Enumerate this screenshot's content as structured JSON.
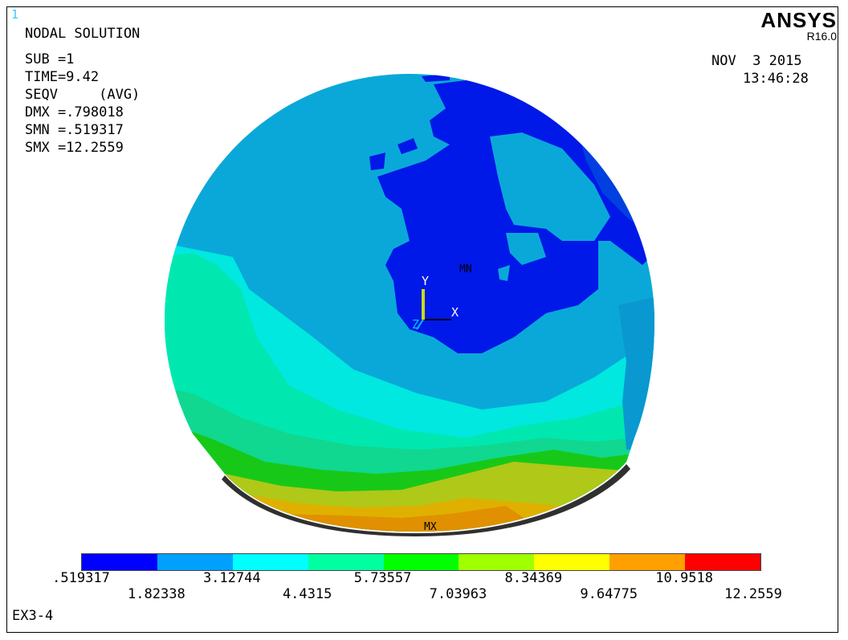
{
  "window_number": "1",
  "product": {
    "name": "ANSYS",
    "release": "R16.0"
  },
  "info": {
    "title": "NODAL SOLUTION",
    "lines": [
      "SUB =1",
      "TIME=9.42",
      "SEQV     (AVG)",
      "DMX =.798018",
      "SMN =.519317",
      "SMX =12.2559"
    ]
  },
  "date": "NOV  3 2015",
  "time": "13:46:28",
  "markers": {
    "min": "MN",
    "max": "MX"
  },
  "triad": {
    "x": "X",
    "y": "Y",
    "z": "Z"
  },
  "legend": {
    "colors": [
      "#0000ff",
      "#00a0ff",
      "#00ffff",
      "#00ffa0",
      "#00ff00",
      "#a0ff00",
      "#ffff00",
      "#ffa000",
      "#ff0000"
    ],
    "values_top": [
      ".519317",
      "3.12744",
      "5.73557",
      "8.34369",
      "10.9518"
    ],
    "values_bottom": [
      "1.82338",
      "4.4315",
      "7.03963",
      "9.64775",
      "12.2559"
    ]
  },
  "file_label": "EX3-4"
}
